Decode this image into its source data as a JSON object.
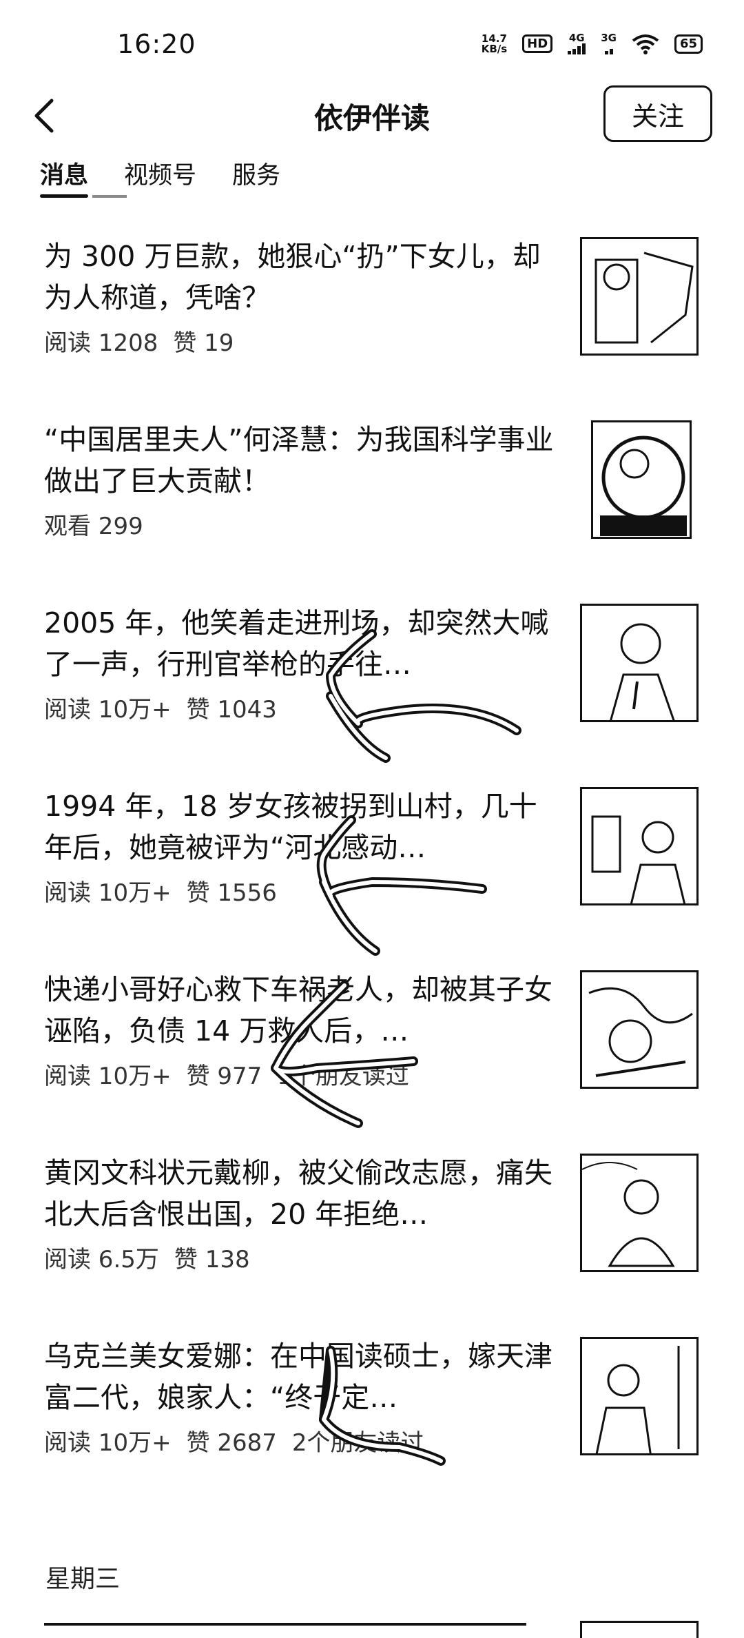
{
  "status": {
    "time": "16:20",
    "net_speed_value": "14.7",
    "net_speed_unit": "KB/s",
    "hd": "HD",
    "sig1": "4G",
    "sig2": "3G",
    "battery": "65"
  },
  "header": {
    "title": "依伊伴读",
    "follow_label": "关注"
  },
  "tabs": [
    {
      "label": "消息"
    },
    {
      "label": "视频号"
    },
    {
      "label": "服务"
    }
  ],
  "feed": [
    {
      "title": "为 300 万巨款，她狠心“扔”下女儿，却为人称道，凭啥？",
      "stat": "阅读 1208",
      "likes": "赞 19",
      "extra": ""
    },
    {
      "title": "“中国居里夫人”何泽慧：为我国科学事业做出了巨大贡献！",
      "stat": "观看 299",
      "likes": "",
      "extra": ""
    },
    {
      "title": "2005 年，他笑着走进刑场，却突然大喊了一声，行刑官举枪的手往…",
      "stat": "阅读 10万+",
      "likes": "赞 1043",
      "extra": ""
    },
    {
      "title": "1994 年，18 岁女孩被拐到山村，几十年后，她竟被评为“河北感动…",
      "stat": "阅读 10万+",
      "likes": "赞 1556",
      "extra": ""
    },
    {
      "title": "快递小哥好心救下车祸老人，却被其子女诬陷，负债 14 万救人后，…",
      "stat": "阅读 10万+",
      "likes": "赞 977",
      "extra": "1个朋友读过"
    },
    {
      "title": "黄冈文科状元戴柳，被父偷改志愿，痛失北大后含恨出国，20 年拒绝…",
      "stat": "阅读 6.5万",
      "likes": "赞 138",
      "extra": ""
    },
    {
      "title": "乌克兰美女爱娜：在中国读硕士，嫁天津富二代，娘家人：“终于定…",
      "stat": "阅读 10万+",
      "likes": "赞 2687",
      "extra": "2个朋友读过"
    }
  ],
  "day_label": "星期三",
  "icons": {
    "back": "chevron-left-icon",
    "thumbnails": "article-thumbnail"
  }
}
